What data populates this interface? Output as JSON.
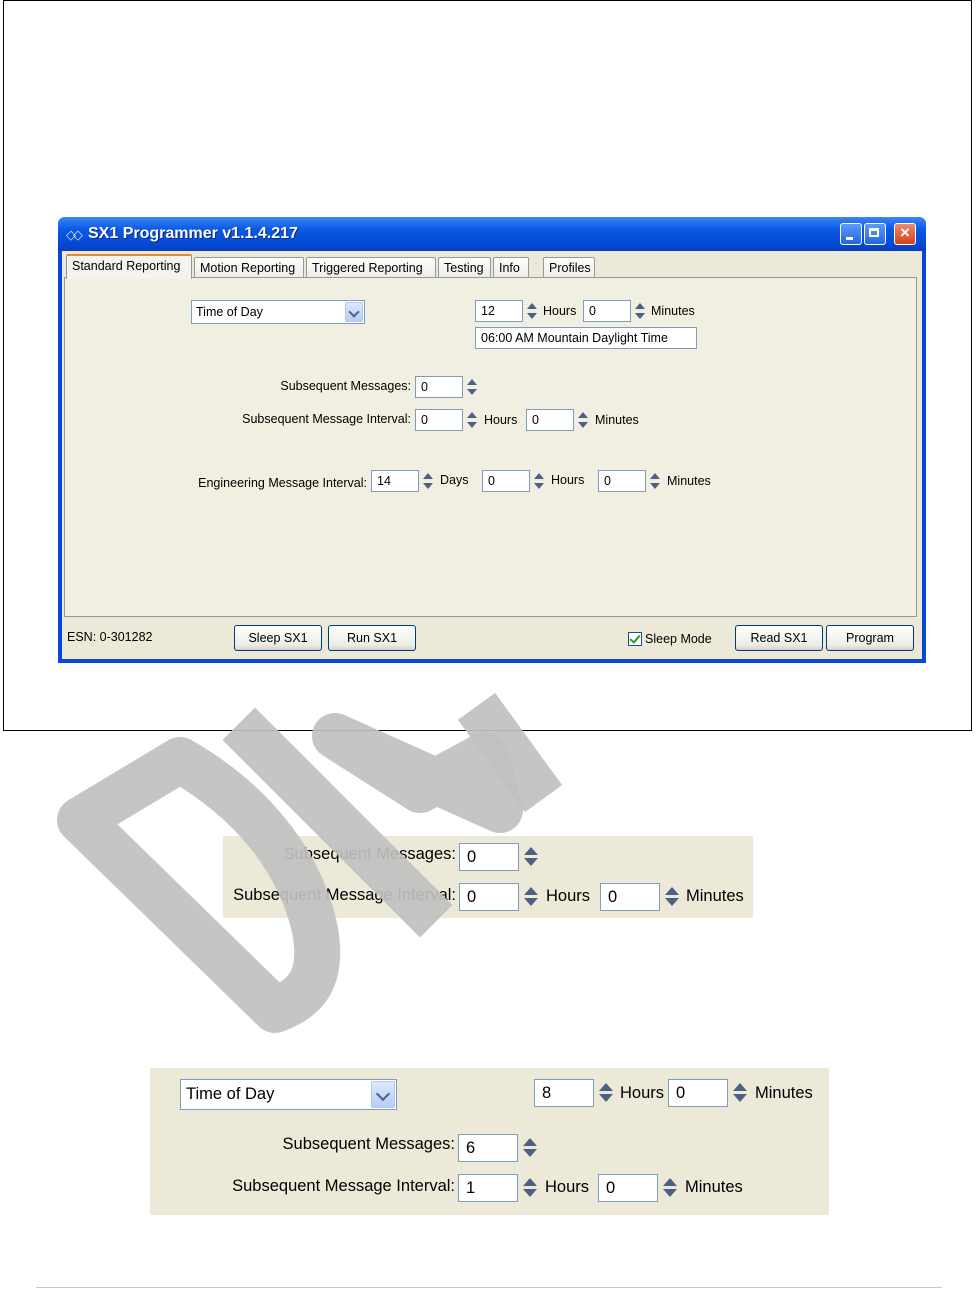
{
  "window": {
    "title": "SX1 Programmer v1.1.4.217",
    "tabs": [
      "Standard Reporting",
      "Motion Reporting",
      "Triggered Reporting",
      "Testing",
      "Info",
      "Profiles"
    ],
    "active_tab": "Standard Reporting",
    "report_mode": "Time of Day",
    "time_hours": "12",
    "time_minutes": "0",
    "labels": {
      "hours": "Hours",
      "minutes": "Minutes",
      "days": "Days",
      "subsequent_messages": "Subsequent Messages:",
      "subsequent_interval": "Subsequent Message Interval:",
      "engineering_interval": "Engineering Message Interval:"
    },
    "time_display": "06:00 AM Mountain Daylight Time",
    "subsequent_messages": "0",
    "subsequent_interval_hours": "0",
    "subsequent_interval_minutes": "0",
    "engineering_days": "14",
    "engineering_hours": "0",
    "engineering_minutes": "0",
    "status": {
      "esn": "ESN: 0-301282",
      "sleep_button": "Sleep SX1",
      "run_button": "Run SX1",
      "sleep_mode_label": "Sleep Mode",
      "sleep_mode_checked": true,
      "read_button": "Read SX1",
      "program_button": "Program"
    }
  },
  "crop1": {
    "subsequent_messages_label": "Subsequent Messages:",
    "subsequent_messages": "0",
    "interval_label": "Subsequent Message Interval:",
    "interval_hours": "0",
    "hours_label": "Hours",
    "interval_minutes": "0",
    "minutes_label": "Minutes"
  },
  "crop2": {
    "report_mode": "Time of Day",
    "time_hours": "8",
    "hours_label": "Hours",
    "time_minutes": "0",
    "minutes_label": "Minutes",
    "subsequent_messages_label": "Subsequent Messages:",
    "subsequent_messages": "6",
    "interval_label": "Subsequent Message Interval:",
    "interval_hours": "1",
    "interval_minutes": "0"
  },
  "colors": {
    "titlebar": "#0a46d8",
    "dialog_bg": "#ece9d8",
    "active_tab_accent": "#e68b2c",
    "watermark": "#c0c0c0"
  }
}
